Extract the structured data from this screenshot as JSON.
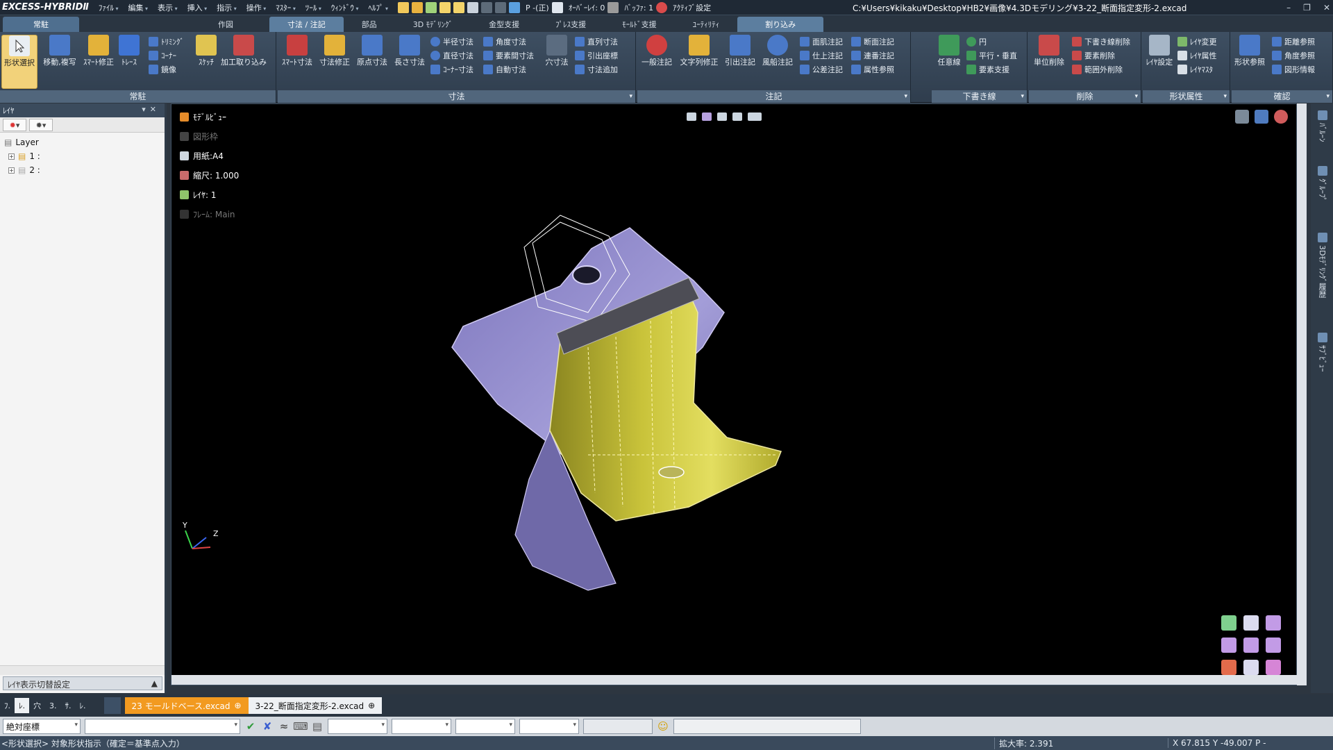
{
  "app": {
    "logo": "EXCESS-HYBRIDⅡ",
    "menus": [
      "ﾌｧｲﾙ",
      "編集",
      "表示",
      "挿入",
      "指示",
      "操作",
      "ﾏｽﾀｰ",
      "ﾂｰﾙ",
      "ｳｨﾝﾄﾞｳ",
      "ﾍﾙﾌﾟ"
    ],
    "quick": {
      "view_state": "P -(正)",
      "overlay": "ｵｰﾊﾞｰﾚｲ: 0",
      "buffer": "ﾊﾞｯﾌｧ: 1",
      "active_setting": "ｱｸﾃｨﾌﾞ設定"
    },
    "file_path": "C:¥Users¥kikaku¥Desktop¥HB2¥画像¥4.3Dモデリング¥3-22_断面指定変形-2.excad"
  },
  "ribbon_tabs": [
    "常駐",
    "作図",
    "寸法 / 注記",
    "部品",
    "3D ﾓﾃﾞﾘﾝｸﾞ",
    "金型支援",
    "ﾌﾟﾚｽ支援",
    "ﾓｰﾙﾄﾞ支援",
    "ﾕｰﾃｨﾘﾃｨ",
    "割り込み"
  ],
  "ribbon": {
    "g1": {
      "label": "常駐",
      "big": [
        "形状選択",
        "移動,複写",
        "ｽﾏｰﾄ修正",
        "ﾄﾚｰｽ",
        "ｽｹｯﾁ",
        "加工取り込み"
      ],
      "small": [
        "ﾄﾘﾐﾝｸﾞ",
        "ｺｰﾅｰ",
        "鏡像"
      ]
    },
    "g2": {
      "label": "寸法",
      "big": [
        "ｽﾏｰﾄ寸法",
        "寸法修正",
        "原点寸法",
        "長さ寸法",
        "穴寸法"
      ],
      "small": [
        "半径寸法",
        "直径寸法",
        "ｺｰﾅｰ寸法",
        "角度寸法",
        "要素間寸法",
        "自動寸法",
        "直列寸法",
        "引出座標",
        "寸法追加"
      ]
    },
    "g3": {
      "label": "注記",
      "big": [
        "一般注記",
        "文字列修正",
        "引出注記",
        "風船注記"
      ],
      "small": [
        "面肌注記",
        "仕上注記",
        "公差注記",
        "断面注記",
        "連番注記",
        "属性参照"
      ]
    },
    "g4": {
      "label": "下書き線",
      "big": [
        "任意線"
      ],
      "small": [
        "円",
        "平行・垂直",
        "要素支援"
      ]
    },
    "g5": {
      "label": "削除",
      "big": [
        "単位削除"
      ],
      "small": [
        "下書き線削除",
        "要素削除",
        "範囲外削除"
      ]
    },
    "g6": {
      "label": "形状属性",
      "big": [
        "ﾚｲﾔ設定"
      ],
      "small": [
        "ﾚｲﾔ変更",
        "ﾚｲﾔ属性",
        "ﾚｲﾔﾏｽﾀ"
      ]
    },
    "g7": {
      "label": "確認",
      "big": [
        "形状参照"
      ],
      "small": [
        "距離参照",
        "角度参照",
        "図形情報"
      ]
    }
  },
  "layer_panel": {
    "title": "ﾚｲﾔ",
    "root": "Layer",
    "items": [
      "1 :",
      "2 :"
    ],
    "footer": "ﾚｲﾔ表示切替設定"
  },
  "viewport": {
    "title": "ﾓﾃﾞﾙﾋﾞｭｰ",
    "frame_label": "図形枠",
    "paper": "用紙:A4",
    "scale": "縮尺: 1.000",
    "layer": "ﾚｲﾔ: 1",
    "frame": "ﾌﾚｰﾑ: Main",
    "axis_y": "Y",
    "axis_z": "Z"
  },
  "right_bar": [
    "ﾊﾞﾙｰﾝ",
    "ｸﾞﾙｰﾌﾟ",
    "3Dﾓﾃﾞﾘﾝｸﾞ履歴",
    "ｻﾌﾞﾋﾞｭｰ"
  ],
  "bottom_panel_tabs": [
    "ﾌ.",
    "ﾚ.",
    "穴",
    "3.",
    "ｻ.",
    "ﾚ."
  ],
  "doc_tabs": [
    {
      "label": "23 モールドベース.excad",
      "active": true
    },
    {
      "label": "3-22_断面指定変形-2.excad",
      "active": false
    }
  ],
  "command_bar": {
    "coord_mode": "絶対座標"
  },
  "status": {
    "message": "<形状選択> 対象形状指示（確定＝基準点入力）",
    "zoom": "拡大率: 2.391",
    "coords": "X 67.815 Y -49.007  P -"
  },
  "colors": {
    "accent": "#f29a20",
    "part_purple": "#8f88c9",
    "part_yellow": "#c8c23a",
    "ribbon_group": "#51667c"
  }
}
